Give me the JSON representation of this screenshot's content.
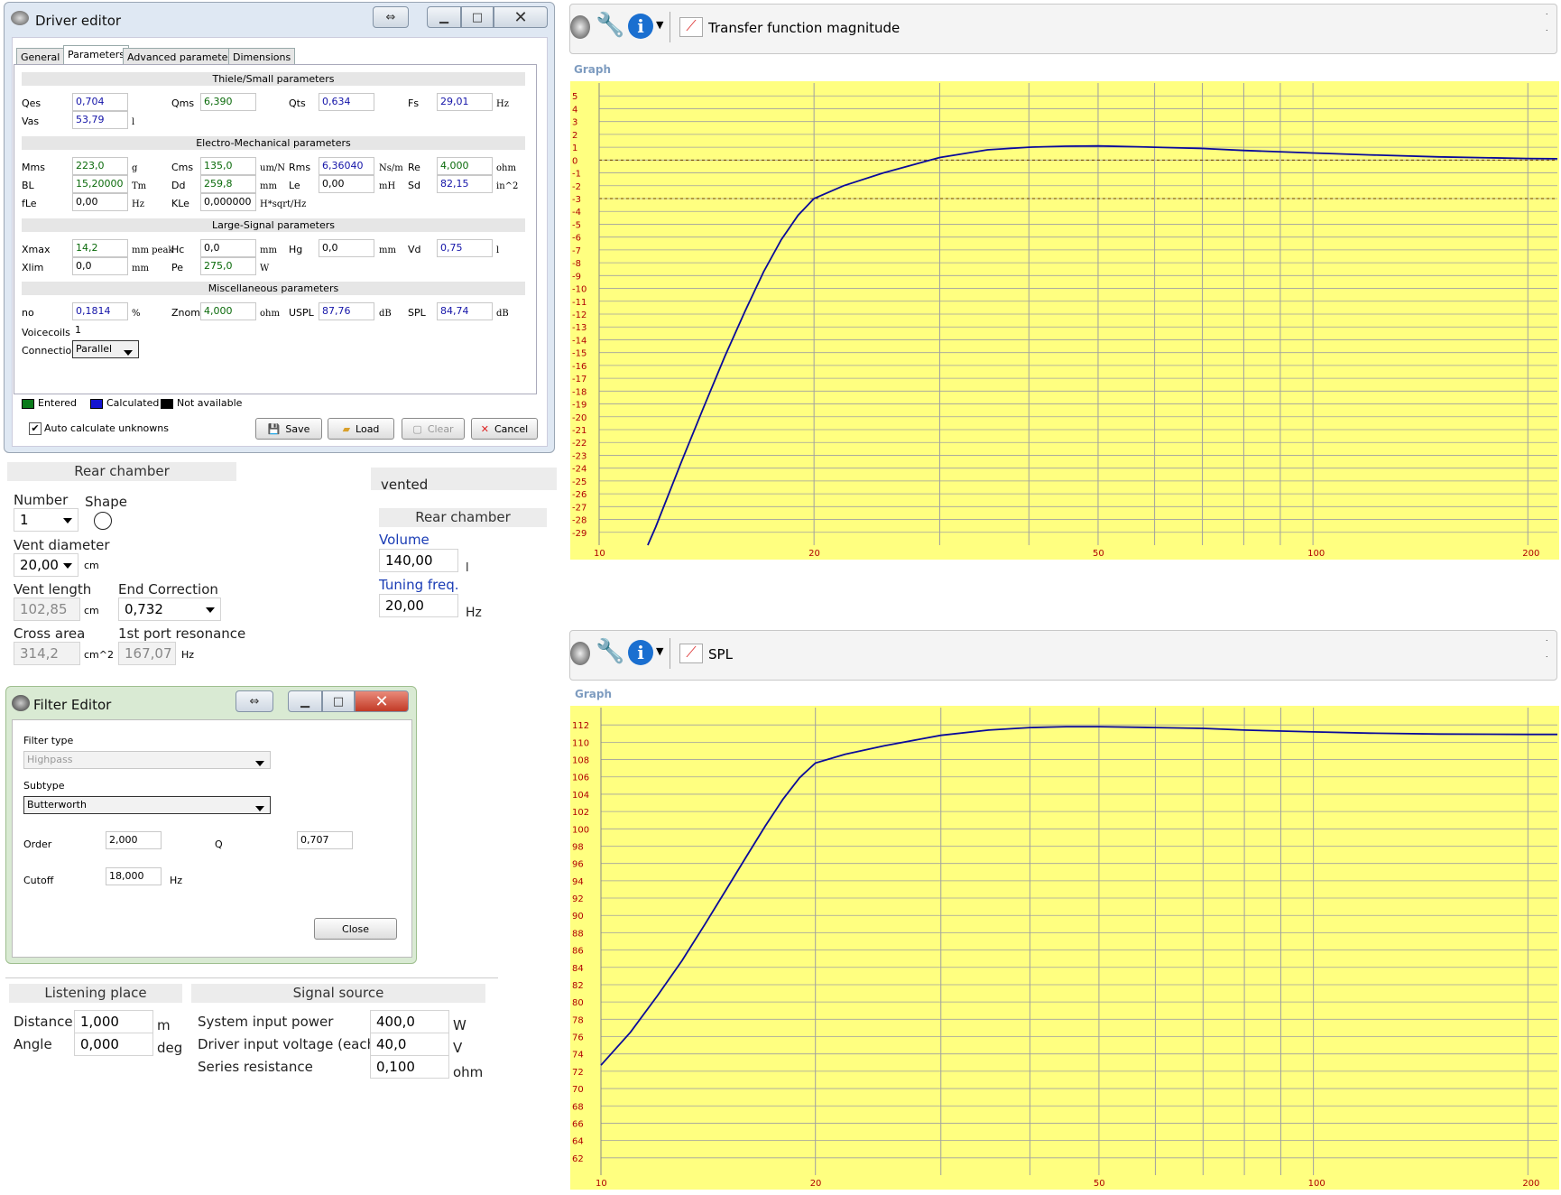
{
  "driver_editor": {
    "title": "Driver editor",
    "tabs": [
      "General",
      "Parameters",
      "Advanced parameters",
      "Dimensions"
    ],
    "sections": {
      "thiele": "Thiele/Small parameters",
      "electro": "Electro-Mechanical parameters",
      "large": "Large-Signal parameters",
      "misc": "Miscellaneous parameters"
    },
    "fields": {
      "qes": {
        "label": "Qes",
        "value": "0,704"
      },
      "qms": {
        "label": "Qms",
        "value": "6,390"
      },
      "qts": {
        "label": "Qts",
        "value": "0,634"
      },
      "fs": {
        "label": "Fs",
        "value": "29,01",
        "unit": "Hz"
      },
      "vas": {
        "label": "Vas",
        "value": "53,79",
        "unit": "l"
      },
      "mms": {
        "label": "Mms",
        "value": "223,0",
        "unit": "g"
      },
      "cms": {
        "label": "Cms",
        "value": "135,0",
        "unit": "um/N"
      },
      "rms": {
        "label": "Rms",
        "value": "6,36040",
        "unit": "Ns/m"
      },
      "re": {
        "label": "Re",
        "value": "4,000",
        "unit": "ohm"
      },
      "bl": {
        "label": "BL",
        "value": "15,20000",
        "unit": "Tm"
      },
      "dd": {
        "label": "Dd",
        "value": "259,8",
        "unit": "mm"
      },
      "le": {
        "label": "Le",
        "value": "0,00",
        "unit": "mH"
      },
      "sd": {
        "label": "Sd",
        "value": "82,15",
        "unit": "in^2"
      },
      "fle": {
        "label": "fLe",
        "value": "0,00",
        "unit": "Hz"
      },
      "kle": {
        "label": "KLe",
        "value": "0,000000",
        "unit": "H*sqrt/Hz"
      },
      "xmax": {
        "label": "Xmax",
        "value": "14,2",
        "unit": "mm peak"
      },
      "hc": {
        "label": "Hc",
        "value": "0,0",
        "unit": "mm"
      },
      "hg": {
        "label": "Hg",
        "value": "0,0",
        "unit": "mm"
      },
      "vd": {
        "label": "Vd",
        "value": "0,75",
        "unit": "l"
      },
      "xlim": {
        "label": "Xlim",
        "value": "0,0",
        "unit": "mm"
      },
      "pe": {
        "label": "Pe",
        "value": "275,0",
        "unit": "W"
      },
      "no": {
        "label": "no",
        "value": "0,1814",
        "unit": "%"
      },
      "znom": {
        "label": "Znom",
        "value": "4,000",
        "unit": "ohm"
      },
      "uspl": {
        "label": "USPL",
        "value": "87,76",
        "unit": "dB"
      },
      "spl": {
        "label": "SPL",
        "value": "84,74",
        "unit": "dB"
      },
      "voicecoils": {
        "label": "Voicecoils",
        "value": "1"
      },
      "connection": {
        "label": "Connection",
        "value": "Parallel"
      }
    },
    "legend": {
      "entered": "Entered",
      "calculated": "Calculated",
      "na": "Not available"
    },
    "auto_calc": "Auto calculate unknowns",
    "buttons": {
      "save": "Save",
      "load": "Load",
      "clear": "Clear",
      "cancel": "Cancel"
    },
    "colors": {
      "entered": "#0a7a1a",
      "calculated": "#1414d0",
      "na": "#000000"
    }
  },
  "rear_chamber_left": {
    "header": "Rear chamber",
    "number_label": "Number",
    "number_value": "1",
    "shape_label": "Shape",
    "vent_diameter_label": "Vent diameter",
    "vent_diameter_value": "20,00",
    "vent_diameter_unit": "cm",
    "vent_length_label": "Vent length",
    "vent_length_value": "102,85",
    "vent_length_unit": "cm",
    "end_corr_label": "End Correction",
    "end_corr_value": "0,732",
    "cross_area_label": "Cross area",
    "cross_area_value": "314,2",
    "cross_area_unit": "cm^2",
    "port_res_label": "1st port resonance",
    "port_res_value": "167,07",
    "port_res_unit": "Hz"
  },
  "rear_chamber_right": {
    "type": "vented",
    "header": "Rear chamber",
    "volume_label": "Volume",
    "volume_value": "140,00",
    "volume_unit": "l",
    "tuning_label": "Tuning freq.",
    "tuning_value": "20,00",
    "tuning_unit": "Hz"
  },
  "filter_editor": {
    "title": "Filter Editor",
    "filter_type_label": "Filter type",
    "filter_type_value": "Highpass",
    "subtype_label": "Subtype",
    "subtype_value": "Butterworth",
    "order_label": "Order",
    "order_value": "2,000",
    "q_label": "Q",
    "q_value": "0,707",
    "cutoff_label": "Cutoff",
    "cutoff_value": "18,000",
    "cutoff_unit": "Hz",
    "close": "Close"
  },
  "listening": {
    "header": "Listening place",
    "distance_label": "Distance",
    "distance_value": "1,000",
    "distance_unit": "m",
    "angle_label": "Angle",
    "angle_value": "0,000",
    "angle_unit": "deg"
  },
  "signal": {
    "header": "Signal source",
    "power_label": "System input power",
    "power_value": "400,0",
    "power_unit": "W",
    "voltage_label": "Driver input voltage (each)",
    "voltage_value": "40,0",
    "voltage_unit": "V",
    "res_label": "Series resistance",
    "res_value": "0,100",
    "res_unit": "ohm"
  },
  "graph_tf": {
    "toolbar_title": "Transfer function magnitude",
    "graph_label": "Graph"
  },
  "graph_spl": {
    "toolbar_title": "SPL",
    "graph_label": "Graph"
  },
  "chart_data": [
    {
      "type": "line",
      "title": "Transfer function magnitude",
      "x_scale": "log",
      "xlim": [
        10,
        220
      ],
      "ylim": [
        -30,
        6
      ],
      "x_tick_labels": [
        10,
        20,
        50,
        100,
        200
      ],
      "y_ticks": [
        5,
        4,
        3,
        2,
        1,
        0,
        -1,
        -2,
        -3,
        -4,
        -5,
        -6,
        -7,
        -8,
        -9,
        -10,
        -11,
        -12,
        -13,
        -14,
        -15,
        -16,
        -17,
        -18,
        -19,
        -20,
        -21,
        -22,
        -23,
        -24,
        -25,
        -26,
        -27,
        -28,
        -29
      ],
      "reference_lines": [
        0,
        -3
      ],
      "grid": true,
      "background": "#ffff80",
      "line_color": "#0a0a9a",
      "series": [
        {
          "x": [
            11.7,
            12,
            13,
            14,
            15,
            16,
            17,
            18,
            19,
            20,
            22,
            25,
            30,
            35,
            40,
            45,
            50,
            60,
            70,
            80,
            100,
            120,
            150,
            200,
            220
          ],
          "y": [
            -30,
            -28.6,
            -23.7,
            -19.3,
            -15.3,
            -11.8,
            -8.7,
            -6.2,
            -4.3,
            -3.0,
            -2.0,
            -1.0,
            0.2,
            0.8,
            1.0,
            1.08,
            1.1,
            1.0,
            0.9,
            0.75,
            0.55,
            0.4,
            0.25,
            0.12,
            0.1
          ]
        }
      ]
    },
    {
      "type": "line",
      "title": "SPL",
      "x_scale": "log",
      "xlim": [
        10,
        220
      ],
      "ylim": [
        60,
        114
      ],
      "x_tick_labels": [
        10,
        20,
        50,
        100,
        200
      ],
      "y_ticks": [
        112,
        110,
        108,
        106,
        104,
        102,
        100,
        98,
        96,
        94,
        92,
        90,
        88,
        86,
        84,
        82,
        80,
        78,
        76,
        74,
        72,
        70,
        68,
        66,
        64,
        62
      ],
      "grid": true,
      "background": "#ffff80",
      "line_color": "#0a0a9a",
      "series": [
        {
          "x": [
            10,
            11,
            12,
            13,
            14,
            15,
            16,
            17,
            18,
            19,
            20,
            22,
            25,
            30,
            35,
            40,
            45,
            50,
            60,
            70,
            80,
            100,
            120,
            150,
            200,
            220
          ],
          "y": [
            72.7,
            76.5,
            80.7,
            84.8,
            89.0,
            93.0,
            96.8,
            100.3,
            103.4,
            105.9,
            107.6,
            108.6,
            109.6,
            110.8,
            111.4,
            111.7,
            111.8,
            111.8,
            111.7,
            111.6,
            111.4,
            111.2,
            111.05,
            110.95,
            110.9,
            110.9
          ]
        }
      ]
    }
  ]
}
